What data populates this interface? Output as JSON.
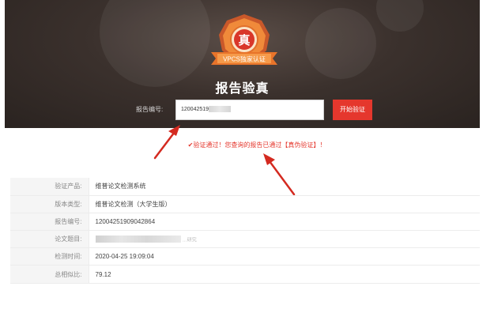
{
  "header": {
    "badge_seal": "真",
    "badge_ribbon": "VPCS独家认证",
    "page_title": "报告验真",
    "report_label": "报告编号:",
    "report_value": "12004251909",
    "verify_button": "开始验证"
  },
  "result": {
    "message": "✔验证通过！您查询的报告已通过【真伪验证】！"
  },
  "info_rows": [
    {
      "label": "验证产品:",
      "value": "维普论文检测系统"
    },
    {
      "label": "版本类型:",
      "value": "维普论文检测（大学生版）"
    },
    {
      "label": "报告编号:",
      "value": "12004251909042864"
    },
    {
      "label": "论文题目:",
      "value": "",
      "tail": "…研究"
    },
    {
      "label": "检测时间:",
      "value": "2020-04-25 19:09:04"
    },
    {
      "label": "总相似比:",
      "value": "79.12"
    }
  ],
  "colors": {
    "accent": "#e5372d",
    "hero_bg": "#3b312d",
    "badge_orange": "#e8742a"
  }
}
